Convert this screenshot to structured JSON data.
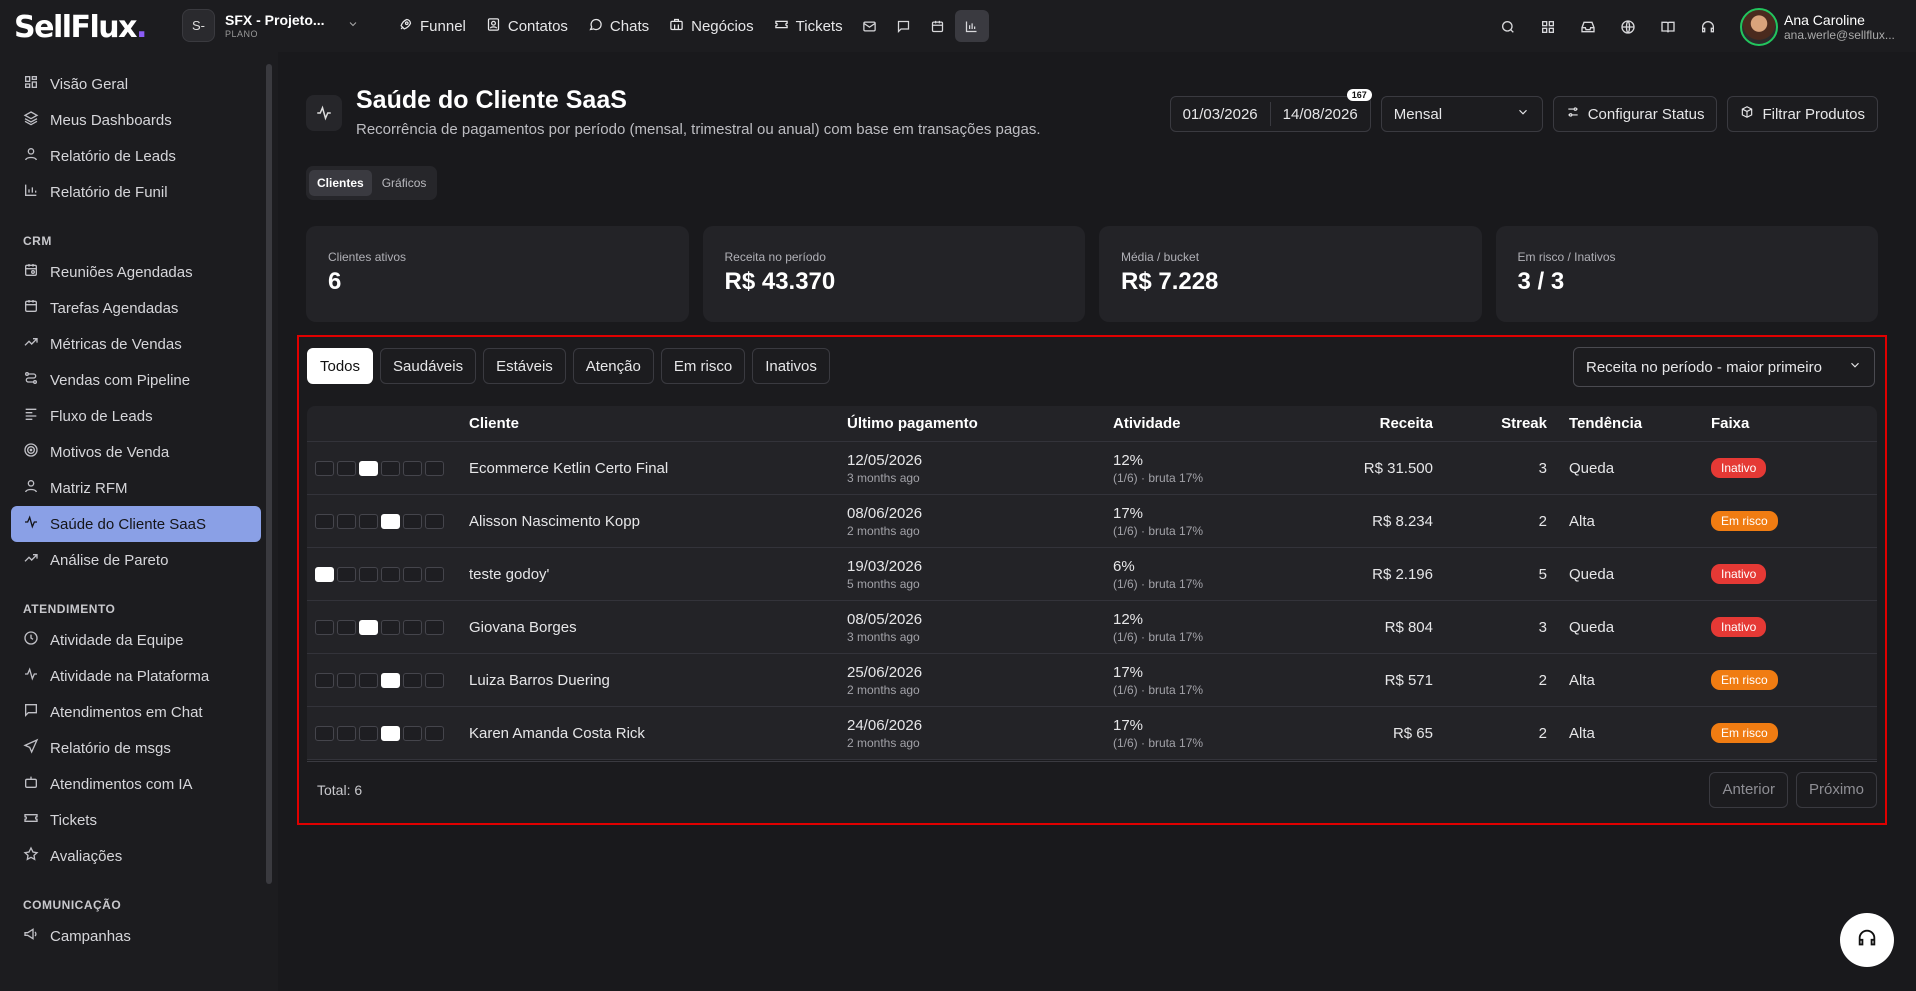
{
  "brand": {
    "logo_text": "SellFlux",
    "logo_dot": "."
  },
  "workspace": {
    "avatar": "S-",
    "name": "SFX - Projeto...",
    "plan": "PLANO"
  },
  "nav": {
    "items": [
      {
        "label": "Funnel",
        "icon": "rocket-icon"
      },
      {
        "label": "Contatos",
        "icon": "contacts-icon"
      },
      {
        "label": "Chats",
        "icon": "chat-icon"
      },
      {
        "label": "Negócios",
        "icon": "briefcase-icon"
      },
      {
        "label": "Tickets",
        "icon": "ticket-icon"
      }
    ],
    "icons": [
      "mail-icon",
      "message-icon",
      "calendar-icon",
      "bar-chart-icon"
    ]
  },
  "user": {
    "name": "Ana Caroline",
    "email": "ana.werle@sellflux..."
  },
  "sidebar": {
    "items_top": [
      {
        "label": "Visão Geral",
        "icon": "grid-icon"
      },
      {
        "label": "Meus Dashboards",
        "icon": "layers-icon"
      },
      {
        "label": "Relatório de Leads",
        "icon": "user-icon"
      },
      {
        "label": "Relatório de Funil",
        "icon": "chart-icon"
      }
    ],
    "crm_title": "CRM",
    "items_crm": [
      {
        "label": "Reuniões Agendadas",
        "icon": "calendar-clock-icon"
      },
      {
        "label": "Tarefas Agendadas",
        "icon": "calendar-icon"
      },
      {
        "label": "Métricas de Vendas",
        "icon": "trend-icon"
      },
      {
        "label": "Vendas com Pipeline",
        "icon": "route-icon"
      },
      {
        "label": "Fluxo de Leads",
        "icon": "list-icon"
      },
      {
        "label": "Motivos de Venda",
        "icon": "target-icon"
      },
      {
        "label": "Matriz RFM",
        "icon": "user-icon"
      },
      {
        "label": "Saúde do Cliente SaaS",
        "icon": "pulse-icon",
        "active": true
      },
      {
        "label": "Análise de Pareto",
        "icon": "trend-icon"
      }
    ],
    "atend_title": "ATENDIMENTO",
    "items_atend": [
      {
        "label": "Atividade da Equipe",
        "icon": "clock-icon"
      },
      {
        "label": "Atividade na Plataforma",
        "icon": "pulse-icon"
      },
      {
        "label": "Atendimentos em Chat",
        "icon": "chat-icon"
      },
      {
        "label": "Relatório de msgs",
        "icon": "send-icon"
      },
      {
        "label": "Atendimentos com IA",
        "icon": "bot-icon"
      },
      {
        "label": "Tickets",
        "icon": "ticket-icon"
      },
      {
        "label": "Avaliações",
        "icon": "star-icon"
      }
    ],
    "com_title": "COMUNICAÇÃO",
    "items_com": [
      {
        "label": "Campanhas",
        "icon": "megaphone-icon"
      }
    ]
  },
  "page": {
    "title": "Saúde do Cliente SaaS",
    "subtitle": "Recorrência de pagamentos por período (mensal, trimestral ou anual) com base em transações pagas.",
    "date_start": "01/03/2026",
    "date_end": "14/08/2026",
    "date_badge": "167",
    "period": "Mensal",
    "config_status": "Configurar Status",
    "filter_products": "Filtrar Produtos",
    "tabs": [
      "Clientes",
      "Gráficos"
    ]
  },
  "kpis": [
    {
      "label": "Clientes ativos",
      "value": "6"
    },
    {
      "label": "Receita no período",
      "value": "R$ 43.370"
    },
    {
      "label": "Média / bucket",
      "value": "R$ 7.228"
    },
    {
      "label": "Em risco / Inativos",
      "value": "3 / 3"
    }
  ],
  "filters": [
    "Todos",
    "Saudáveis",
    "Estáveis",
    "Atenção",
    "Em risco",
    "Inativos"
  ],
  "sort": "Receita no período - maior primeiro",
  "table": {
    "headers": {
      "cliente": "Cliente",
      "ultimo": "Último pagamento",
      "atividade": "Atividade",
      "receita": "Receita",
      "streak": "Streak",
      "tendencia": "Tendência",
      "faixa": "Faixa"
    },
    "rows": [
      {
        "active_box": 2,
        "cliente": "Ecommerce Ketlin Certo Final",
        "data": "12/05/2026",
        "ago": "3 months ago",
        "pct": "12%",
        "detail": "(1/6) · bruta 17%",
        "receita": "R$ 31.500",
        "streak": "3",
        "tendencia": "Queda",
        "faixa": "Inativo",
        "faixa_type": "inativo"
      },
      {
        "active_box": 3,
        "cliente": "Alisson Nascimento Kopp",
        "data": "08/06/2026",
        "ago": "2 months ago",
        "pct": "17%",
        "detail": "(1/6) · bruta 17%",
        "receita": "R$ 8.234",
        "streak": "2",
        "tendencia": "Alta",
        "faixa": "Em risco",
        "faixa_type": "risco"
      },
      {
        "active_box": 0,
        "cliente": "teste godoy'",
        "data": "19/03/2026",
        "ago": "5 months ago",
        "pct": "6%",
        "detail": "(1/6) · bruta 17%",
        "receita": "R$ 2.196",
        "streak": "5",
        "tendencia": "Queda",
        "faixa": "Inativo",
        "faixa_type": "inativo"
      },
      {
        "active_box": 2,
        "cliente": "Giovana Borges",
        "data": "08/05/2026",
        "ago": "3 months ago",
        "pct": "12%",
        "detail": "(1/6) · bruta 17%",
        "receita": "R$ 804",
        "streak": "3",
        "tendencia": "Queda",
        "faixa": "Inativo",
        "faixa_type": "inativo"
      },
      {
        "active_box": 3,
        "cliente": "Luiza Barros Duering",
        "data": "25/06/2026",
        "ago": "2 months ago",
        "pct": "17%",
        "detail": "(1/6) · bruta 17%",
        "receita": "R$ 571",
        "streak": "2",
        "tendencia": "Alta",
        "faixa": "Em risco",
        "faixa_type": "risco"
      },
      {
        "active_box": 3,
        "cliente": "Karen Amanda Costa Rick",
        "data": "24/06/2026",
        "ago": "2 months ago",
        "pct": "17%",
        "detail": "(1/6) · bruta 17%",
        "receita": "R$ 65",
        "streak": "2",
        "tendencia": "Alta",
        "faixa": "Em risco",
        "faixa_type": "risco"
      }
    ]
  },
  "footer": {
    "total": "Total: 6",
    "prev": "Anterior",
    "next": "Próximo"
  }
}
